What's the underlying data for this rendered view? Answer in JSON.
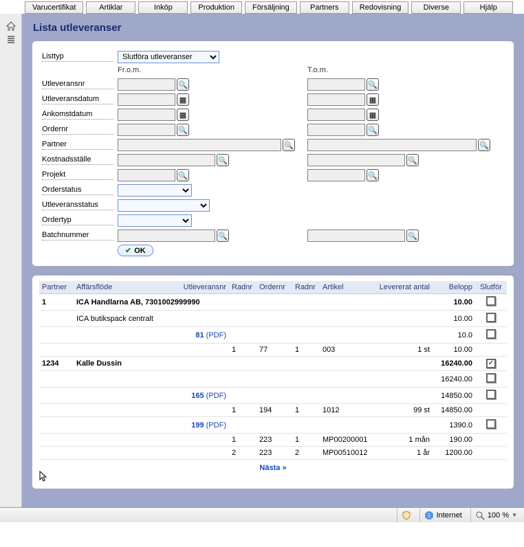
{
  "tabs": [
    "Varucertifikat",
    "Artiklar",
    "Inköp",
    "Produktion",
    "Försäljning",
    "Partners",
    "Redovisning",
    "Diverse",
    "Hjälp"
  ],
  "page_title": "Lista utleveranser",
  "labels": {
    "listtyp": "Listtyp",
    "from": "Fr.o.m.",
    "to": "T.o.m.",
    "utleveransnr": "Utleveransnr",
    "utleveransdatum": "Utleveransdatum",
    "ankomstdatum": "Ankomstdatum",
    "ordernr": "Ordernr",
    "partner": "Partner",
    "kostnadsstalle": "Kostnadsställe",
    "projekt": "Projekt",
    "orderstatus": "Orderstatus",
    "utleveransstatus": "Utleveransstatus",
    "ordertyp": "Ordertyp",
    "batchnummer": "Batchnummer",
    "ok": "OK"
  },
  "listtyp_value": "Slutföra utleveranser",
  "columns": {
    "partner": "Partner",
    "affarsflode": "Affärsflöde",
    "utleveransnr": "Utleveransnr",
    "radnr1": "Radnr",
    "ordernr": "Ordernr",
    "radnr2": "Radnr",
    "artikel": "Artikel",
    "levererat_antal": "Levererat antal",
    "belopp": "Belopp",
    "slutfor": "Slutför"
  },
  "group1": {
    "partner": "1",
    "title": "ICA Handlarna AB, 7301002999990",
    "belopp": "10.00",
    "sub1": {
      "affarsflode": "ICA butikspack centralt",
      "belopp": "10.00"
    },
    "utlev": {
      "nr": "81",
      "pdf": " (PDF)",
      "belopp": "10.0"
    },
    "line": {
      "radnr1": "1",
      "ordernr": "77",
      "radnr2": "1",
      "artikel": "003",
      "antal": "1 st",
      "belopp": "10.00"
    }
  },
  "group2": {
    "partner": "1234",
    "title": "Kalle Dussin",
    "belopp": "16240.00",
    "sub1": {
      "belopp": "16240.00"
    },
    "utlev1": {
      "nr": "165",
      "pdf": " (PDF)",
      "belopp": "14850.00"
    },
    "line1": {
      "radnr1": "1",
      "ordernr": "194",
      "radnr2": "1",
      "artikel": "1012",
      "antal": "99 st",
      "belopp": "14850.00"
    },
    "utlev2": {
      "nr": "199",
      "pdf": " (PDF)",
      "belopp": "1390.0"
    },
    "line2": {
      "radnr1": "1",
      "ordernr": "223",
      "radnr2": "1",
      "artikel": "MP00200001",
      "antal": "1 mån",
      "belopp": "190.00"
    },
    "line3": {
      "radnr1": "2",
      "ordernr": "223",
      "radnr2": "2",
      "artikel": "MP00510012",
      "antal": "1 år",
      "belopp": "1200.00"
    }
  },
  "next": "Nästa »",
  "status": {
    "zone": "Internet",
    "zoom": "100 %"
  }
}
